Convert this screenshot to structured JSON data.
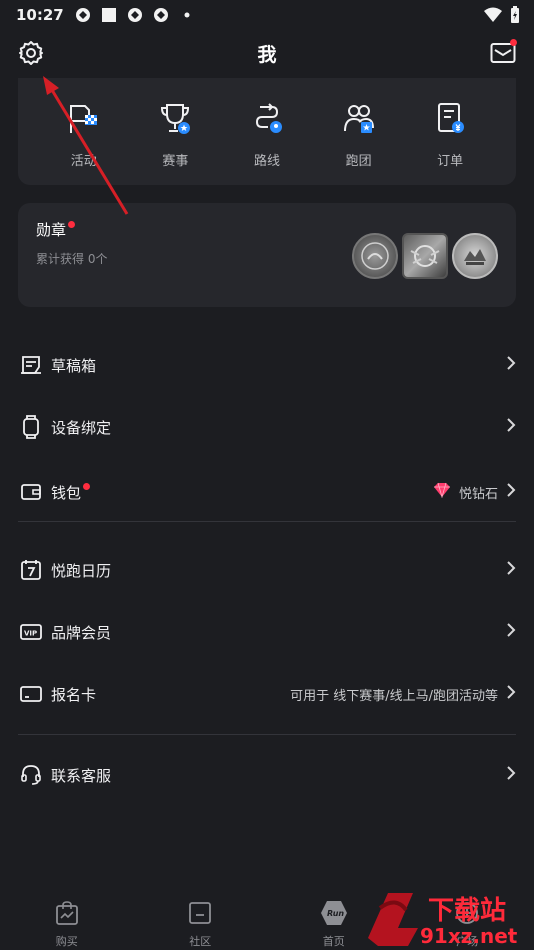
{
  "status_bar": {
    "time": "10:27"
  },
  "header": {
    "title": "我"
  },
  "actions": [
    {
      "label": "活动",
      "icon": "flag-icon"
    },
    {
      "label": "赛事",
      "icon": "trophy-icon"
    },
    {
      "label": "路线",
      "icon": "route-icon"
    },
    {
      "label": "跑团",
      "icon": "group-icon"
    },
    {
      "label": "订单",
      "icon": "order-icon"
    }
  ],
  "medal_card": {
    "title": "勋章",
    "subtitle": "累计获得 0个"
  },
  "menu": {
    "drafts": {
      "label": "草稿箱"
    },
    "device": {
      "label": "设备绑定"
    },
    "wallet": {
      "label": "钱包",
      "right_text": "悦钻石"
    },
    "calendar": {
      "label": "悦跑日历"
    },
    "membership": {
      "label": "品牌会员"
    },
    "signup_card": {
      "label": "报名卡",
      "right_text": "可用于 线下赛事/线上马/跑团活动等"
    },
    "service": {
      "label": "联系客服"
    }
  },
  "tabbar": [
    {
      "label": "购买",
      "icon": "shopping-bag-icon"
    },
    {
      "label": "社区",
      "icon": "community-icon"
    },
    {
      "label": "首页",
      "icon": "home-hexagon-icon",
      "icon_text": "Run"
    },
    {
      "label": "广场",
      "icon": "plaza-icon"
    }
  ],
  "watermark": {
    "text_top": "下载站",
    "text_bottom": "91xz.net"
  },
  "colors": {
    "background": "#1c1d21",
    "card": "#26272c",
    "accent_blue": "#2a8cff",
    "badge_red": "#ff2d3f",
    "annotation_red": "#d61f26"
  }
}
